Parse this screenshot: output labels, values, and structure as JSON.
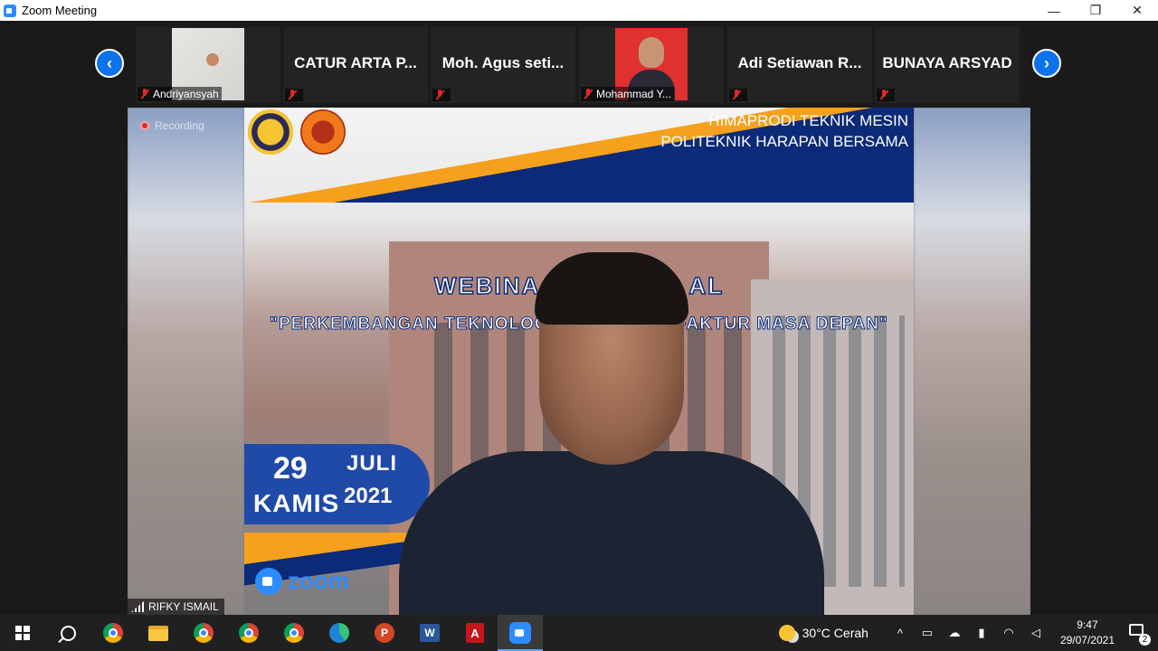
{
  "window": {
    "title": "Zoom Meeting",
    "minimize": "—",
    "restore": "❐",
    "close": "✕"
  },
  "strip": {
    "prev_glyph": "‹",
    "next_glyph": "›",
    "participants": [
      {
        "label": "Andriyansyah",
        "tile_text": "",
        "has_photo": true
      },
      {
        "label": "",
        "tile_text": "CATUR ARTA P..."
      },
      {
        "label": "",
        "tile_text": "Moh. Agus seti..."
      },
      {
        "label": "Mohammad Y...",
        "tile_text": "",
        "has_photo": true
      },
      {
        "label": "",
        "tile_text": "Adi Setiawan R..."
      },
      {
        "label": "",
        "tile_text": "BUNAYA ARSYAD"
      }
    ]
  },
  "main": {
    "recording_label": "Recording",
    "speaker_name": "RIFKY ISMAIL",
    "slide": {
      "org_line1": "HIMAPRODI TEKNIK MESIN",
      "org_line2": "POLITEKNIK HARAPAN BERSAMA",
      "title": "WEBINA                  AL",
      "subtitle": "\"PERKEMBANGAN TEKNOLOGI                   UFAKTUR MASA DEPAN\"",
      "day": "29",
      "month": "JULI",
      "weekday": "KAMIS",
      "year": "2021",
      "platform": "zoom"
    }
  },
  "taskbar": {
    "ppt_glyph": "P",
    "word_glyph": "W",
    "pdf_glyph": "A",
    "weather": "30°C  Cerah",
    "tray_chevron": "^",
    "time": "9:47",
    "date": "29/07/2021",
    "notifications": "2"
  }
}
